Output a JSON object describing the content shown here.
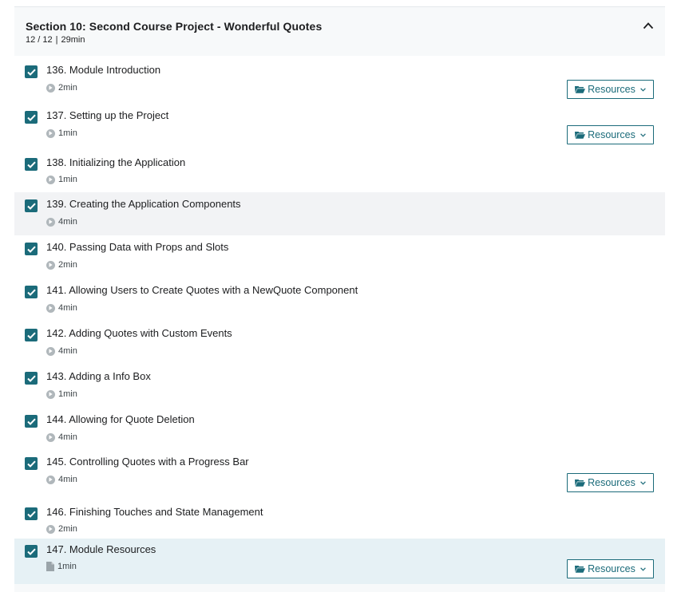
{
  "section": {
    "title": "Section 10: Second Course Project - Wonderful Quotes",
    "progress": "12 / 12",
    "separator": "|",
    "duration": "29min"
  },
  "resources_label": "Resources",
  "colors": {
    "accent": "#1b6b7a",
    "hover_row": "#f2f3f5",
    "active_row": "#e6f1f5"
  },
  "items": [
    {
      "title": "136. Module Introduction",
      "duration": "2min",
      "icon": "play-icon",
      "resources": true,
      "checked": true
    },
    {
      "title": "137. Setting up the Project",
      "duration": "1min",
      "icon": "play-icon",
      "resources": true,
      "checked": true
    },
    {
      "title": "138. Initializing the Application",
      "duration": "1min",
      "icon": "play-icon",
      "resources": false,
      "checked": true
    },
    {
      "title": "139. Creating the Application Components",
      "duration": "4min",
      "icon": "play-icon",
      "resources": false,
      "checked": true
    },
    {
      "title": "140. Passing Data with Props and Slots",
      "duration": "2min",
      "icon": "play-icon",
      "resources": false,
      "checked": true
    },
    {
      "title": "141. Allowing Users to Create Quotes with a NewQuote Component",
      "duration": "4min",
      "icon": "play-icon",
      "resources": false,
      "checked": true
    },
    {
      "title": "142. Adding Quotes with Custom Events",
      "duration": "4min",
      "icon": "play-icon",
      "resources": false,
      "checked": true
    },
    {
      "title": "143. Adding a Info Box",
      "duration": "1min",
      "icon": "play-icon",
      "resources": false,
      "checked": true
    },
    {
      "title": "144. Allowing for Quote Deletion",
      "duration": "4min",
      "icon": "play-icon",
      "resources": false,
      "checked": true
    },
    {
      "title": "145. Controlling Quotes with a Progress Bar",
      "duration": "4min",
      "icon": "play-icon",
      "resources": true,
      "checked": true
    },
    {
      "title": "146. Finishing Touches and State Management",
      "duration": "2min",
      "icon": "play-icon",
      "resources": false,
      "checked": true
    },
    {
      "title": "147. Module Resources",
      "duration": "1min",
      "icon": "file-icon",
      "resources": true,
      "checked": true
    }
  ]
}
